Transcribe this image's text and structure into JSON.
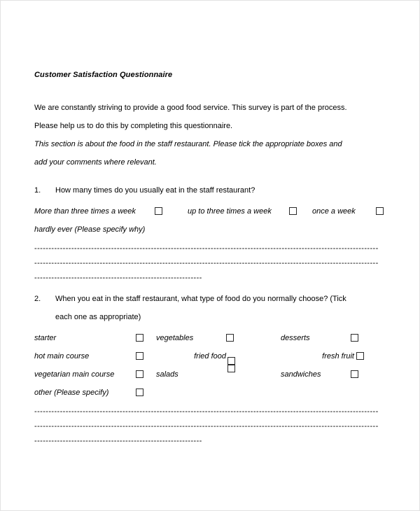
{
  "document": {
    "title": "Customer Satisfaction Questionnaire",
    "intro_line_1": "We are constantly striving to provide a good food service. This survey is part of the process.",
    "intro_line_2": "Please help us to do this by completing this questionnaire.",
    "instruction_line_1": "This section is about the food in the staff restaurant. Please tick the appropriate boxes and",
    "instruction_line_2": "add your comments where relevant."
  },
  "question1": {
    "number": "1.",
    "text": "How many times do you usually eat in the staff restaurant?",
    "options": [
      {
        "label": "More than three times a week"
      },
      {
        "label": "up to three times a week"
      },
      {
        "label": "once a week"
      },
      {
        "label": "hardly ever (Please specify why)"
      }
    ],
    "answer_rules": [
      "-------------------------------------------------------------------------------------------------------------------------",
      "-------------------------------------------------------------------------------------------------------------------------",
      "-----------------------------------------------------------"
    ]
  },
  "question2": {
    "number": "2.",
    "text_line_1": "When you eat in the staff restaurant, what type of food do you normally choose? (Tick",
    "text_line_2": "each one as appropriate)",
    "options": [
      {
        "label": "starter"
      },
      {
        "label": "vegetables"
      },
      {
        "label": "desserts"
      },
      {
        "label": "hot main course"
      },
      {
        "label": "fried food"
      },
      {
        "label": "fresh fruit"
      },
      {
        "label": "vegetarian main course"
      },
      {
        "label": "salads"
      },
      {
        "label": "sandwiches"
      },
      {
        "label": "other (Please specify)"
      }
    ],
    "answer_rules": [
      "-------------------------------------------------------------------------------------------------------------------------",
      "-------------------------------------------------------------------------------------------------------------------------",
      "-----------------------------------------------------------"
    ]
  }
}
